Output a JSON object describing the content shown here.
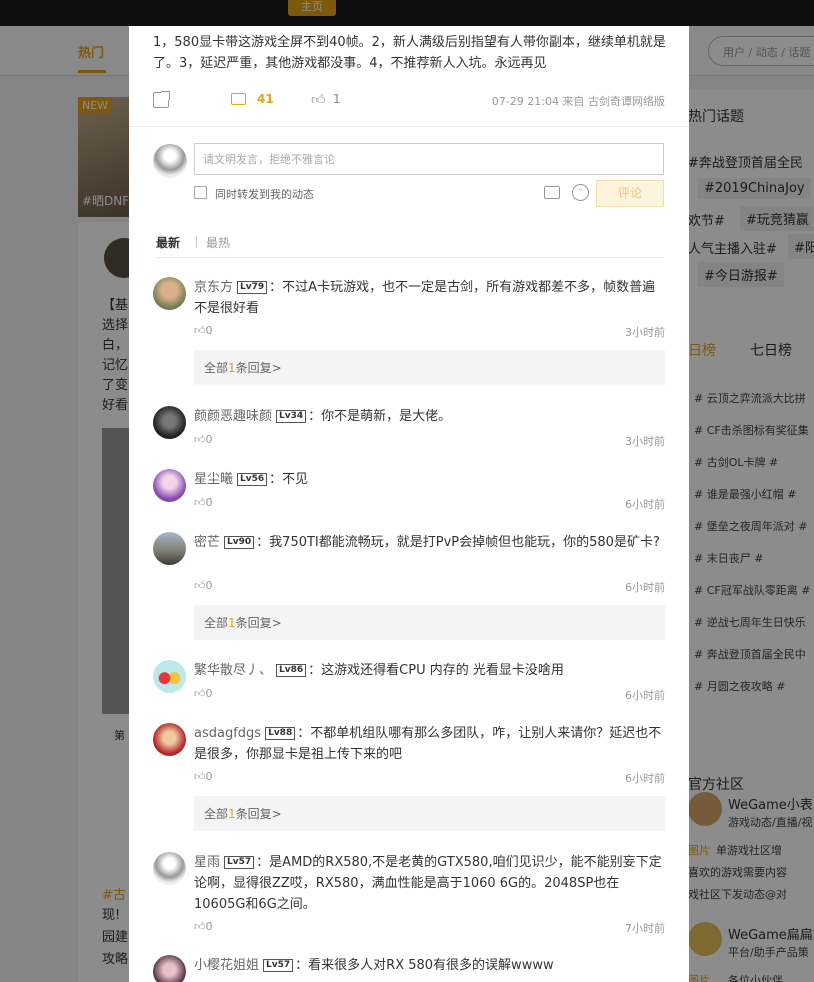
{
  "header": {
    "home_label": "主页"
  },
  "background": {
    "nav_hot": "热门",
    "search_placeholder": "用户 / 动态 / 话题",
    "new_badge": "NEW",
    "banner_text": "#晒DNF",
    "left_text_lines": [
      "【基",
      "选择",
      "白，",
      "记忆",
      "了变",
      "好看"
    ],
    "left_bottom": "第",
    "left_bottom2_lines": [
      "#古",
      "现!",
      "园建",
      "攻略"
    ],
    "right_title": "热门话题",
    "right_tags": [
      "#奔战登顶首届全民",
      "#2019ChinaJoy",
      "欢节#",
      "#玩竞猜赢",
      "人气主播入驻#",
      "#阳",
      "#今日游报#"
    ],
    "rank_tabs": [
      "日榜",
      "七日榜"
    ],
    "rank_items": [
      "# 云顶之弈流派大比拼",
      "# CF击杀图标有奖征集",
      "# 古剑OL卡牌 #",
      "# 谁是最强小红帽 #",
      "# 堡垒之夜周年派对 #",
      "# 末日丧尸 #",
      "# CF冠军战队零距离 #",
      "# 逆战七周年生日快乐",
      "# 奔战登顶首届全民中",
      "# 月圆之夜攻略 #"
    ],
    "official_title": "官方社区",
    "official_items": [
      {
        "name": "WeGame小表",
        "desc": "游戏动态/直播/视"
      },
      {
        "name": "WeGame扁扁",
        "desc": "平台/助手产品策"
      }
    ],
    "official_text": [
      "图片",
      "单游戏社区增",
      "喜欢的游戏需要内容",
      "戏社区下发动态@对",
      "图片",
      "各位小伙伴"
    ]
  },
  "post": {
    "text": "1，580显卡带这游戏全屏不到40帧。2，新人满级后别指望有人带你副本，继续单机就是了。3，延迟严重，其他游戏都没事。4，不推荐新人入坑。永远再见",
    "comment_count": "41",
    "like_count": "1",
    "time_source": "07-29 21:04  来自  古剑奇谭网络版"
  },
  "composer": {
    "placeholder": "请文明发言，拒绝不雅言论",
    "forward_label": "同时转发到我的动态",
    "submit_label": "评论"
  },
  "tabs": {
    "newest": "最新",
    "hottest": "最热"
  },
  "comments": [
    {
      "name": "京东方",
      "level": "Lv79",
      "text": "不过A卡玩游戏，也不一定是古剑，所有游戏都差不多，帧数普遍不是很好看",
      "likes": "0",
      "time": "3小时前",
      "reply": {
        "prefix": "全部",
        "count": "1",
        "suffix": "条回复>"
      }
    },
    {
      "name": "颜颜恶趣味颜",
      "level": "Lv34",
      "text": "你不是萌新，是大佬。",
      "likes": "0",
      "time": "3小时前"
    },
    {
      "name": "星尘曦",
      "level": "Lv56",
      "text": "不见",
      "likes": "0",
      "time": "6小时前"
    },
    {
      "name": "密芒",
      "level": "Lv90",
      "text": "我750TI都能流畅玩，就是打PvP会掉帧但也能玩，你的580是矿卡?",
      "likes": "0",
      "time": "6小时前",
      "reply": {
        "prefix": "全部",
        "count": "1",
        "suffix": "条回复>"
      }
    },
    {
      "name": "繁华散尽丿、",
      "level": "Lv86",
      "text": "这游戏还得看CPU 内存的 光看显卡没啥用",
      "likes": "0",
      "time": "6小时前"
    },
    {
      "name": "asdagfdgs",
      "level": "Lv88",
      "text": "不都单机组队哪有那么多团队，咋，让别人来请你？延迟也不是很多，你那显卡是祖上传下来的吧",
      "likes": "0",
      "time": "6小时前",
      "reply": {
        "prefix": "全部",
        "count": "1",
        "suffix": "条回复>"
      }
    },
    {
      "name": "星雨",
      "level": "Lv57",
      "text": "是AMD的RX580,不是老黄的GTX580,咱们见识少，能不能别妄下定论啊，显得很ZZ哎，RX580，满血性能是高于1060 6G的。2048SP也在10605G和6G之间。",
      "likes": "0",
      "time": "7小时前"
    },
    {
      "name": "小樱花姐姐",
      "level": "Lv57",
      "text": "看来很多人对RX 580有很多的误解wwww",
      "likes": "",
      "time": ""
    }
  ]
}
